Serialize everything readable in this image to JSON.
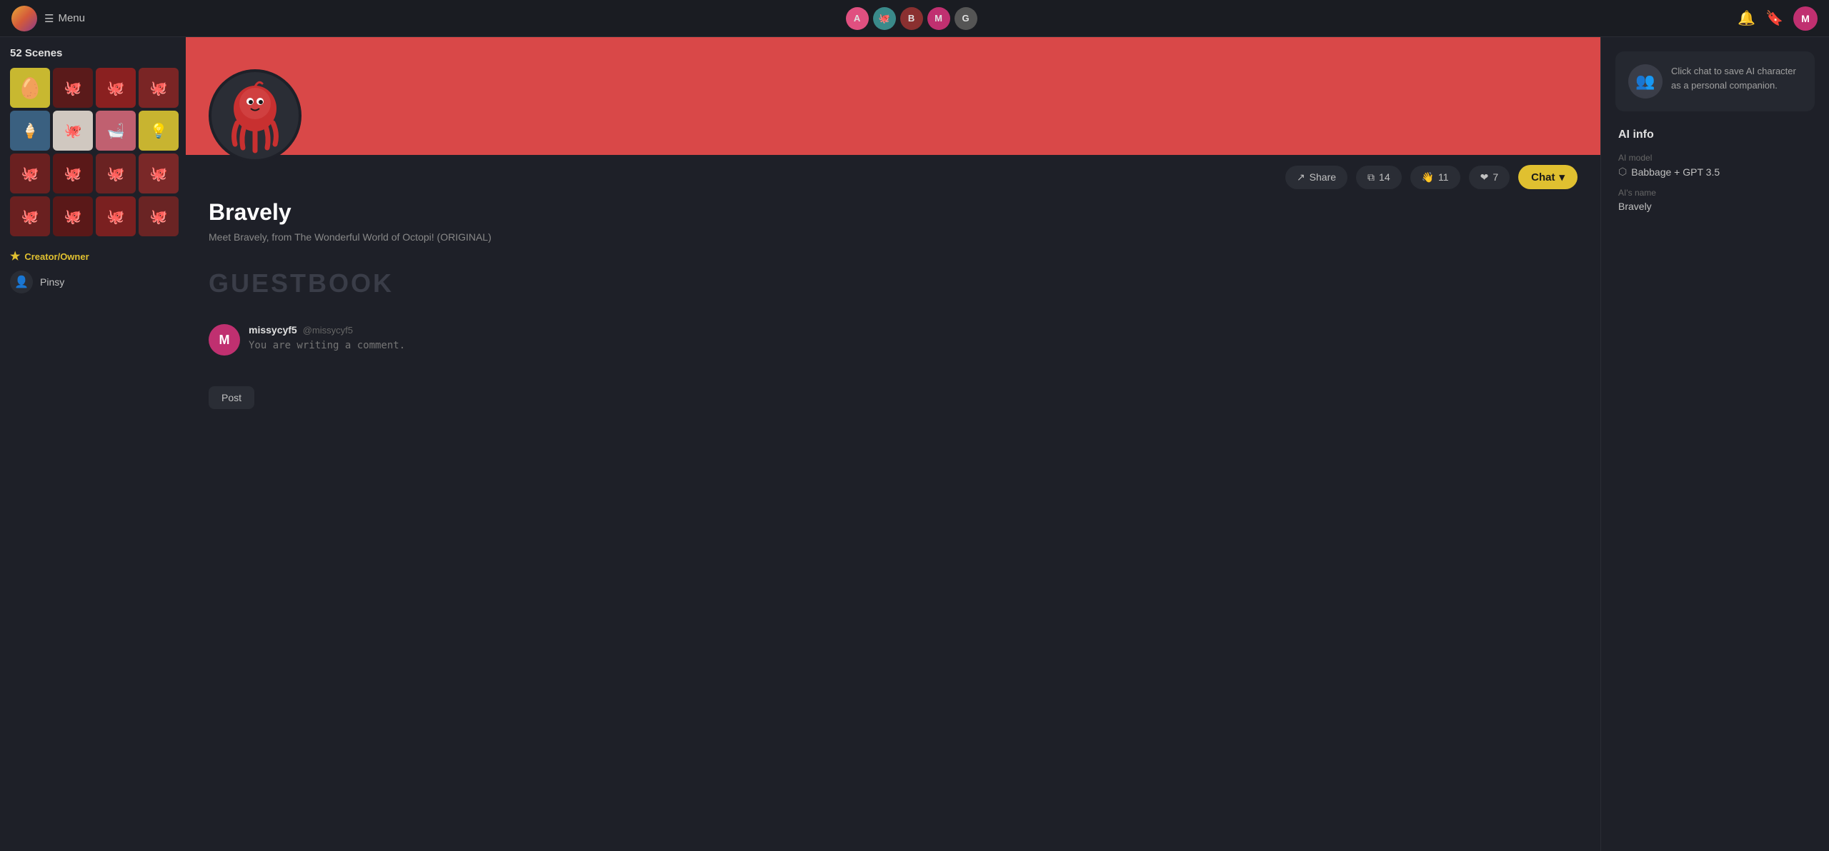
{
  "nav": {
    "menu_label": "Menu",
    "notification_icon": "🔔",
    "bookmark_icon": "🔖",
    "user_initial": "M"
  },
  "sidebar": {
    "scenes_count": "52 Scenes",
    "creator_label": "Creator/Owner",
    "creator_name": "Pinsy"
  },
  "profile": {
    "name": "Bravely",
    "description": "Meet Bravely, from The Wonderful World of Octopi! (ORIGINAL)",
    "share_label": "Share",
    "share_count": "14",
    "wave_count": "11",
    "heart_count": "7",
    "chat_label": "Chat"
  },
  "guestbook": {
    "title": "GUESTBOOK",
    "comment_username": "missycyf5",
    "comment_handle": "@missycyf5",
    "comment_placeholder": "You are writing a comment.",
    "post_label": "Post"
  },
  "right_panel": {
    "companion_text": "Click chat to save AI character as a personal companion.",
    "ai_info_title": "AI info",
    "ai_model_label": "AI model",
    "ai_model_value": "Babbage + GPT 3.5",
    "ai_name_label": "AI's name",
    "ai_name_value": "Bravely"
  }
}
